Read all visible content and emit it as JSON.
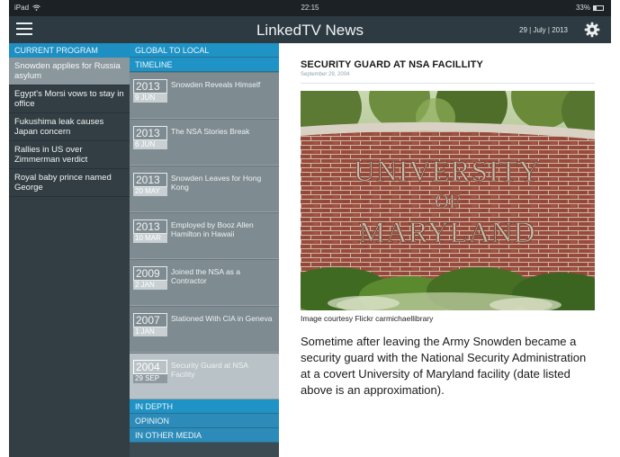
{
  "status_bar": {
    "device": "iPad",
    "time": "22:15",
    "battery": "33%"
  },
  "header": {
    "title": "LinkedTV News",
    "date": "29 | July | 2013"
  },
  "program": {
    "header": "CURRENT PROGRAM",
    "items": [
      {
        "label": "Snowden applies for Russia asylum",
        "active": true
      },
      {
        "label": "Egypt's Morsi vows to stay in office",
        "active": false
      },
      {
        "label": "Fukushima leak causes Japan concern",
        "active": false
      },
      {
        "label": "Rallies in US over Zimmerman verdict",
        "active": false
      },
      {
        "label": "Royal baby prince named George",
        "active": false
      }
    ]
  },
  "timeline": {
    "top_sections": [
      "GLOBAL TO LOCAL",
      "TIMELINE"
    ],
    "items": [
      {
        "year": "2013",
        "day": "9 JUN",
        "title": "Snowden Reveals Himself"
      },
      {
        "year": "2013",
        "day": "6 JUN",
        "title": "The NSA Stories Break"
      },
      {
        "year": "2013",
        "day": "20 MAY",
        "title": "Snowden Leaves for Hong Kong"
      },
      {
        "year": "2013",
        "day": "10 MAR",
        "title": "Employed by Booz Allen Hamilton in Hawaii"
      },
      {
        "year": "2009",
        "day": "2 JAN",
        "title": "Joined the NSA as a Contractor"
      },
      {
        "year": "2007",
        "day": "1 JAN",
        "title": "Stationed With CIA in Geneva"
      },
      {
        "year": "2004",
        "day": "29 SEP",
        "title": "Security Guard at NSA Facility",
        "selected": true
      }
    ],
    "bottom_sections": [
      "IN DEPTH",
      "OPINION",
      "IN OTHER MEDIA"
    ]
  },
  "article": {
    "title": "SECURITY GUARD AT NSA FACILLITY",
    "date": "September 29, 2004",
    "image_text": [
      "UNIVERSITY",
      "OF",
      "MARYLAND"
    ],
    "caption": "Image courtesy Flickr carmichaellibrary",
    "body": "Sometime after leaving the Army Snowden became a security guard with the National Security Administration at a covert University of Maryland facility (date listed above is an approximation)."
  },
  "colors": {
    "accent": "#1f93c6",
    "navbar": "#2d3a41",
    "sidebar": "#323e44",
    "timeline_item": "#7e8b91",
    "timeline_selected": "#b9c2c6"
  },
  "icons": {
    "menu": "hamburger-icon",
    "settings": "gear-icon",
    "wifi": "wifi-icon",
    "battery": "battery-icon"
  }
}
